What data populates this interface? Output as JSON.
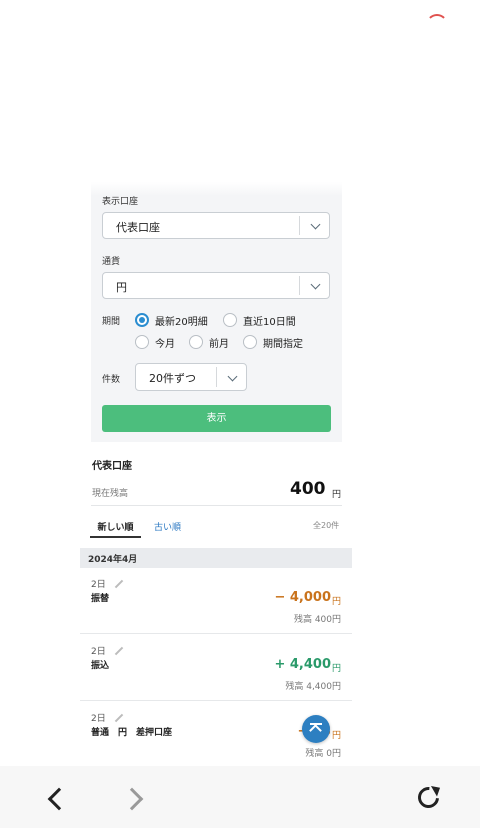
{
  "form": {
    "display_account_label": "表示口座",
    "display_account_value": "代表口座",
    "currency_label": "通貨",
    "currency_value": "円",
    "period_label": "期間",
    "period_options": [
      "最新20明細",
      "直近10日間",
      "今月",
      "前月",
      "期間指定"
    ],
    "period_selected": "最新20明細",
    "count_label": "件数",
    "count_value": "20件ずつ",
    "show_button": "表示"
  },
  "account": {
    "name": "代表口座",
    "balance_label": "現在残高",
    "balance_amount": "400",
    "balance_unit": "円"
  },
  "tabs": {
    "newest": "新しい順",
    "oldest": "古い順",
    "total": "全20件"
  },
  "month_header": "2024年4月",
  "transactions": [
    {
      "day": "2日",
      "desc": "振替",
      "amount": "− 4,000",
      "unit": "円",
      "balance": "残高 400円",
      "type": "withdrawal"
    },
    {
      "day": "2日",
      "desc": "振込",
      "amount": "+ 4,400",
      "unit": "円",
      "balance": "残高 4,400円",
      "type": "deposit"
    },
    {
      "day": "2日",
      "desc": "普通　円　差押口座",
      "amount": "− 23",
      "unit": "円",
      "balance": "残高 0円",
      "type": "withdrawal"
    }
  ],
  "colors": {
    "primary_button": "#4cbe7d",
    "link": "#2b78c2",
    "withdrawal": "#c9731c",
    "deposit": "#2a9a6a",
    "radio_selected": "#2b8dd0"
  },
  "icons": {
    "loading": "spinner-icon",
    "dropdown": "chevron-down-icon",
    "edit": "pencil-icon",
    "scroll_top": "scroll-to-top-icon",
    "back": "chevron-left-icon",
    "forward": "chevron-right-icon",
    "reload": "reload-icon"
  }
}
